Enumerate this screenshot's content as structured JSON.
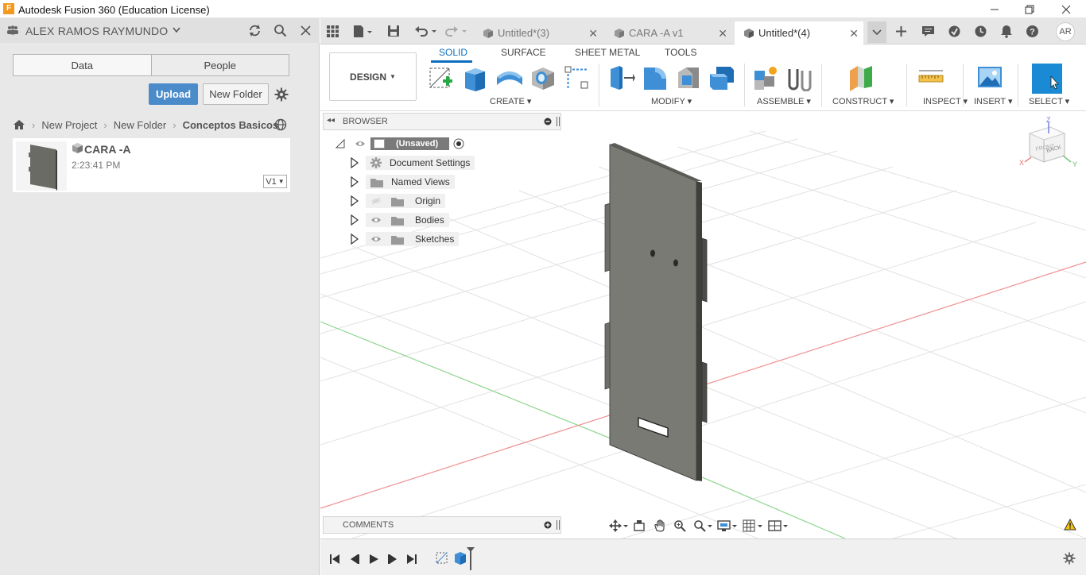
{
  "window": {
    "title": "Autodesk Fusion 360 (Education License)",
    "logo_letter": "F"
  },
  "data_panel": {
    "user_name": "ALEX RAMOS RAYMUNDO",
    "tabs": [
      "Data",
      "People"
    ],
    "upload_label": "Upload",
    "new_folder_label": "New Folder",
    "breadcrumb": [
      "New Project",
      "New Folder",
      "Conceptos Basicos"
    ],
    "items": [
      {
        "name": "CARA -A",
        "time": "2:23:41 PM",
        "version": "V1"
      }
    ]
  },
  "doc_tabs": [
    {
      "label": "Untitled*(3)",
      "active": false
    },
    {
      "label": "CARA -A v1",
      "active": false
    },
    {
      "label": "Untitled*(4)",
      "active": true
    }
  ],
  "user_initials": "AR",
  "toolbar": {
    "workspace": "DESIGN",
    "ribbon_tabs": [
      "SOLID",
      "SURFACE",
      "SHEET METAL",
      "TOOLS"
    ],
    "active_tab": "SOLID",
    "groups": [
      "CREATE",
      "MODIFY",
      "ASSEMBLE",
      "CONSTRUCT",
      "INSPECT",
      "INSERT",
      "SELECT"
    ]
  },
  "browser": {
    "title": "BROWSER",
    "root": "(Unsaved)",
    "nodes": [
      "Document Settings",
      "Named Views",
      "Origin",
      "Bodies",
      "Sketches"
    ]
  },
  "comments_label": "COMMENTS",
  "viewcube": {
    "front": "FRONT",
    "back": "BACK",
    "x": "X",
    "y": "Y",
    "z": "Z"
  },
  "colors": {
    "accent": "#0d6ebf",
    "upload": "#4c8bca",
    "body": "#7a7a74",
    "logo": "#f39a1e"
  }
}
